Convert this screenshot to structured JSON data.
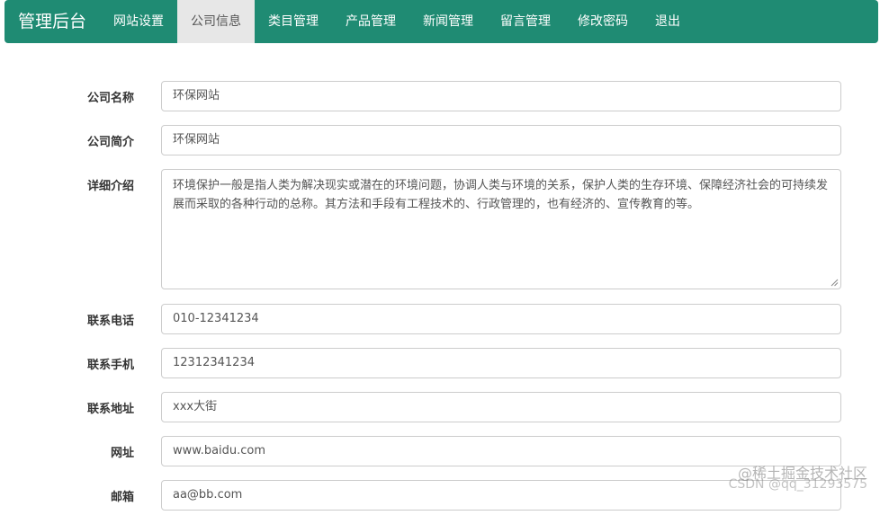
{
  "navbar": {
    "brand": "管理后台",
    "items": [
      {
        "label": "网站设置",
        "active": false
      },
      {
        "label": "公司信息",
        "active": true
      },
      {
        "label": "类目管理",
        "active": false
      },
      {
        "label": "产品管理",
        "active": false
      },
      {
        "label": "新闻管理",
        "active": false
      },
      {
        "label": "留言管理",
        "active": false
      },
      {
        "label": "修改密码",
        "active": false
      },
      {
        "label": "退出",
        "active": false
      }
    ],
    "color": "#1f8b73"
  },
  "form": {
    "company_name": {
      "label": "公司名称",
      "value": "环保网站"
    },
    "company_summary": {
      "label": "公司简介",
      "value": "环保网站"
    },
    "detail": {
      "label": "详细介绍",
      "value": "环境保护一般是指人类为解决现实或潜在的环境问题，协调人类与环境的关系，保护人类的生存环境、保障经济社会的可持续发展而采取的各种行动的总称。其方法和手段有工程技术的、行政管理的，也有经济的、宣传教育的等。"
    },
    "phone": {
      "label": "联系电话",
      "value": "010-12341234"
    },
    "mobile": {
      "label": "联系手机",
      "value": "12312341234"
    },
    "address": {
      "label": "联系地址",
      "value": "xxx大街"
    },
    "website": {
      "label": "网址",
      "value": "www.baidu.com"
    },
    "email": {
      "label": "邮箱",
      "value": "aa@bb.com"
    }
  },
  "watermark": {
    "line1": "@稀土掘金技术社区",
    "line2": "CSDN @qq_31293575"
  }
}
